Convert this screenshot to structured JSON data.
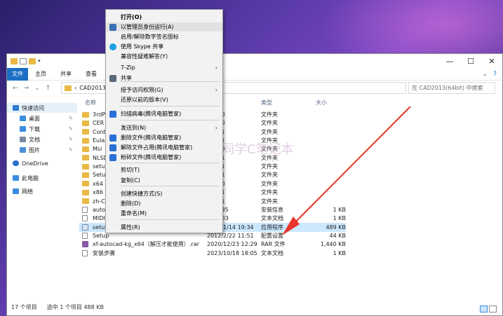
{
  "window": {
    "title_controls": {
      "minimize": "—",
      "maximize": "☐",
      "close": "✕"
    },
    "ribbon_tabs": [
      "文件",
      "主页",
      "共享",
      "查看"
    ],
    "address": "CAD2013(64bit)",
    "search_placeholder": "在 CAD2013(64bit) 中搜索"
  },
  "sidebar": {
    "items": [
      {
        "label": "快速访问",
        "icon": "star-icon",
        "color": "#2f7bd4"
      },
      {
        "label": "桌面",
        "icon": "desktop-icon",
        "color": "#3b8de0"
      },
      {
        "label": "下载",
        "icon": "download-icon",
        "color": "#3b8de0"
      },
      {
        "label": "文档",
        "icon": "document-icon",
        "color": "#7a8aa0"
      },
      {
        "label": "图片",
        "icon": "picture-icon",
        "color": "#4a90d9"
      },
      {
        "label": "OneDrive",
        "icon": "cloud-icon",
        "color": "#2a6fc9"
      },
      {
        "label": "此电脑",
        "icon": "computer-icon",
        "color": "#3b8de0"
      },
      {
        "label": "网络",
        "icon": "network-icon",
        "color": "#3b8de0"
      }
    ]
  },
  "columns": {
    "name": "名称",
    "type": "类型",
    "size": "大小"
  },
  "files": [
    {
      "name": "3rdP",
      "date": "5 9:00",
      "type": "文件夹",
      "size": "",
      "kind": "folder"
    },
    {
      "name": "CER",
      "date": "5 9:00",
      "type": "文件夹",
      "size": "",
      "kind": "folder"
    },
    {
      "name": "Cont",
      "date": "5 9:01",
      "type": "文件夹",
      "size": "",
      "kind": "folder"
    },
    {
      "name": "Eula",
      "date": "5 9:01",
      "type": "文件夹",
      "size": "",
      "kind": "folder"
    },
    {
      "name": "Msi",
      "date": "5 9:00",
      "type": "文件夹",
      "size": "",
      "kind": "folder"
    },
    {
      "name": "NLSD",
      "date": "5 9:01",
      "type": "文件夹",
      "size": "",
      "kind": "folder"
    },
    {
      "name": "setup",
      "date": "5 9:01",
      "type": "文件夹",
      "size": "",
      "kind": "folder"
    },
    {
      "name": "Setup",
      "date": "5 9:01",
      "type": "文件夹",
      "size": "",
      "kind": "folder"
    },
    {
      "name": "x64",
      "date": "5 9:00",
      "type": "文件夹",
      "size": "",
      "kind": "folder"
    },
    {
      "name": "x86",
      "date": "5 9:01",
      "type": "文件夹",
      "size": "",
      "kind": "folder"
    },
    {
      "name": "zh-C",
      "date": "5 9:01",
      "type": "文件夹",
      "size": "",
      "kind": "folder"
    },
    {
      "name": "auto",
      "date": "2 16:35",
      "type": "安装信息",
      "size": "1 KB",
      "kind": "doc"
    },
    {
      "name": "MIDI",
      "date": "2 22:03",
      "type": "文本文档",
      "size": "1 KB",
      "kind": "doc"
    },
    {
      "name": "setup",
      "date": "2014/1/14 19:34",
      "type": "应用程序",
      "size": "489 KB",
      "kind": "exe",
      "selected": true
    },
    {
      "name": "Setup",
      "date": "2012/2/22 11:51",
      "type": "配置设置",
      "size": "44 KB",
      "kind": "doc"
    },
    {
      "name": "xf-autocad-kg_x64（解压才能使用）.rar",
      "date": "2020/12/23 12:29",
      "type": "RAR 文件",
      "size": "1,440 KB",
      "kind": "rar"
    },
    {
      "name": "安装步骤",
      "date": "2023/10/18 18:05",
      "type": "文本文档",
      "size": "1 KB",
      "kind": "doc"
    }
  ],
  "status": {
    "count": "17 个项目",
    "selection": "选中 1 个项目  488 KB"
  },
  "context_menu": {
    "items": [
      {
        "label": "打开(O)",
        "bold": true
      },
      {
        "label": "以管理员身份运行(A)",
        "icon": "shield-icon",
        "hover": true
      },
      {
        "label": "启用/解除数字签名图标"
      },
      {
        "label": "使用 Skype 共享",
        "icon": "skype-icon"
      },
      {
        "label": "兼容性疑难解答(Y)"
      },
      {
        "label": "7-Zip",
        "submenu": true
      },
      {
        "label": "共享",
        "icon": "share-icon"
      },
      {
        "label": "授予访问权限(G)",
        "submenu": true
      },
      {
        "label": "还原以前的版本(V)"
      },
      {
        "label": "扫描病毒(腾讯电脑管家)",
        "icon": "antivirus-icon"
      },
      {
        "label": "发送到(N)",
        "submenu": true
      },
      {
        "label": "删除文件(腾讯电脑管家)",
        "icon": "delete-file-icon"
      },
      {
        "label": "解除文件占用(腾讯电脑管家)",
        "icon": "unlock-file-icon"
      },
      {
        "label": "粉碎文件(腾讯电脑管家)",
        "icon": "shred-file-icon"
      },
      {
        "label": "剪切(T)"
      },
      {
        "label": "复制(C)"
      },
      {
        "label": "创建快捷方式(S)"
      },
      {
        "label": "删除(D)"
      },
      {
        "label": "重命名(M)"
      },
      {
        "label": "属性(R)"
      }
    ]
  },
  "watermark_text": "同学C笔记本",
  "colors": {
    "accent": "#1a6fc4",
    "selection": "#cce8ff",
    "arrow": "#e8352b",
    "folder": "#e9b945"
  }
}
